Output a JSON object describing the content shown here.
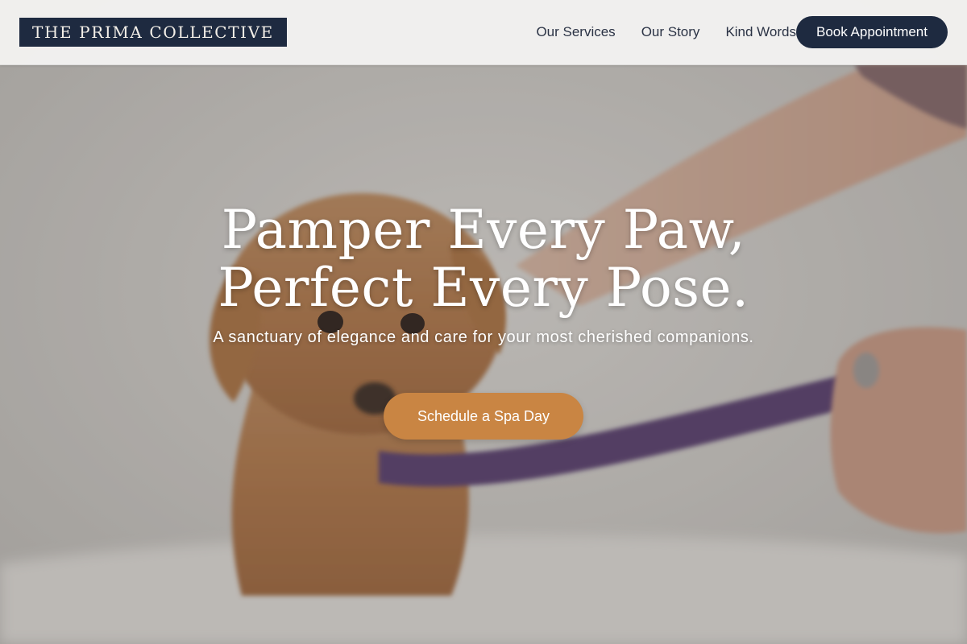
{
  "header": {
    "logo_text": "THE PRIMA COLLECTIVE",
    "nav_items": [
      {
        "label": "Our Services"
      },
      {
        "label": "Our Story"
      },
      {
        "label": "Kind Words"
      }
    ],
    "book_label": "Book Appointment"
  },
  "hero": {
    "headline_line1": "Pamper Every Paw,",
    "headline_line2": "Perfect Every Pose.",
    "subtitle": "A sanctuary of elegance and care for your most cherished companions.",
    "cta_label": "Schedule a Spa Day",
    "background_image": "wet-puppy-with-purple-leash-photo"
  },
  "colors": {
    "brand_navy": "#1e2a40",
    "cta_orange": "#c98543",
    "header_bg": "#f4f3f2",
    "nav_text": "#2b3345"
  }
}
